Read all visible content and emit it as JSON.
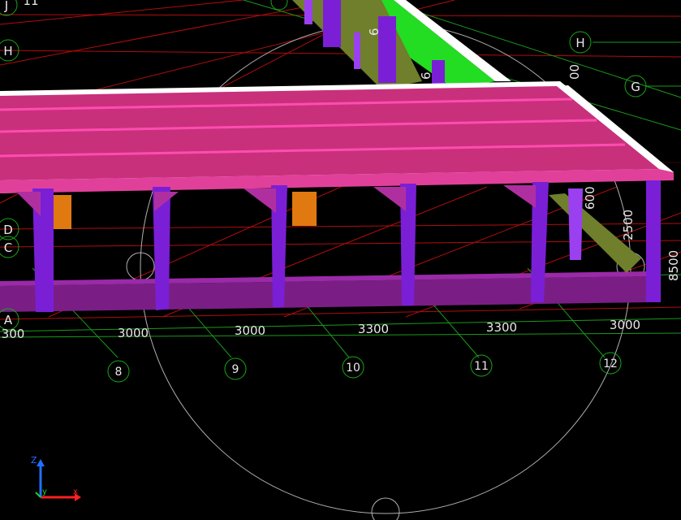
{
  "colors": {
    "background": "#000000",
    "grid_red": "#d01010",
    "grid_green": "#1a9a1a",
    "bubble": "#18a818",
    "label": "#e8e8e8",
    "slab_top": "#c8307c",
    "slab_side": "#e0409a",
    "slab_edge": "#ffffff",
    "column": "#7a1fd6",
    "column_light": "#9b40f0",
    "beam": "#7a1e86",
    "footing": "#e07a10",
    "green_member": "#22dd22",
    "olive_member": "#6f7f2c",
    "orbit": "#b0b0b0",
    "axis_x": "#ff2020",
    "axis_y": "#20d020",
    "axis_z": "#2070ff"
  },
  "grid": {
    "row_labels_left": [
      "J",
      "H",
      "D",
      "C",
      "A"
    ],
    "row_labels_right": [
      "H",
      "G"
    ],
    "corner_label": "11",
    "column_bubbles": [
      "8",
      "9",
      "10",
      "11",
      "12"
    ],
    "bay_dims": [
      "300",
      "3000",
      "3000",
      "3300",
      "3300",
      "3000"
    ],
    "vertical_dims": [
      "600",
      "2500",
      "8500"
    ],
    "partial_dims": [
      "6",
      "6",
      "00"
    ]
  },
  "view": {
    "orbit_circle": "orbit",
    "axis_triad": {
      "x": "x",
      "y": "y",
      "z": "Z"
    }
  }
}
